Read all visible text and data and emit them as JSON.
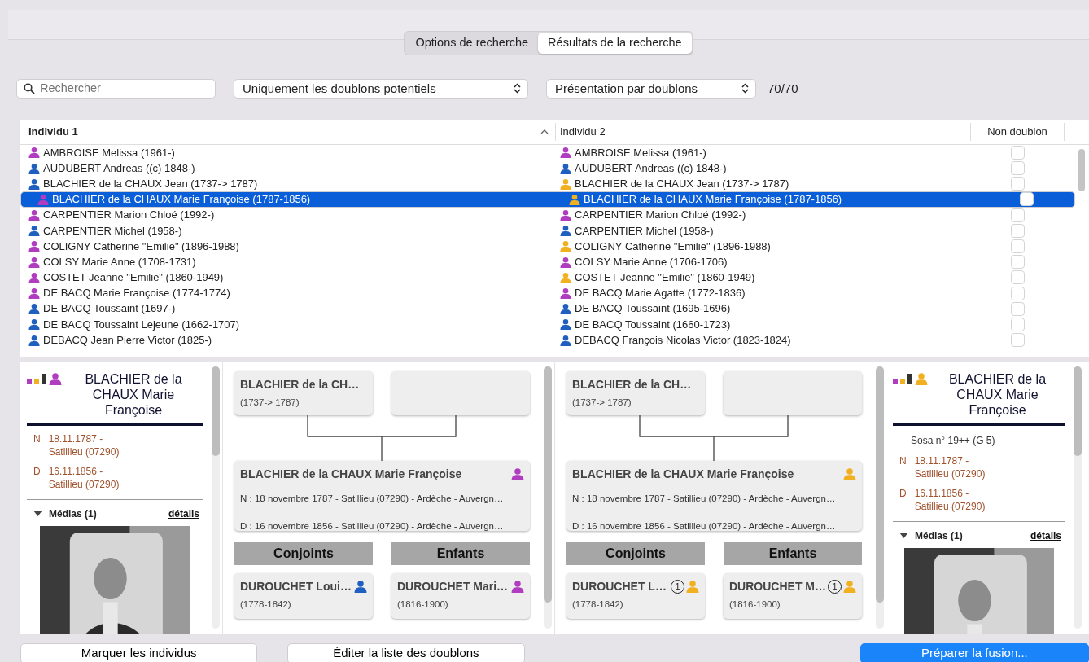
{
  "tabs": [
    {
      "label": "Options de recherche",
      "selected": false
    },
    {
      "label": "Résultats de la recherche",
      "selected": true
    }
  ],
  "search": {
    "placeholder": "Rechercher"
  },
  "filter_select": "Uniquement les doublons potentiels",
  "view_select": "Présentation par doublons",
  "count": "70/70",
  "table": {
    "columns": [
      "Individu 1",
      "Individu 2",
      "Non doublon"
    ],
    "rows": [
      {
        "person_1": {
          "name": "AMBROISE Melissa (1961-)",
          "color": "#b03cc0"
        },
        "person_2": {
          "name": "AMBROISE Melissa (1961-)",
          "color": "#b03cc0"
        },
        "non_doublon": false,
        "selected": false
      },
      {
        "person_1": {
          "name": "AUDUBERT Andreas ((c) 1848-)",
          "color": "#1f5fbf"
        },
        "person_2": {
          "name": "AUDUBERT Andreas ((c) 1848-)",
          "color": "#1f5fbf"
        },
        "non_doublon": false,
        "selected": false
      },
      {
        "person_1": {
          "name": "BLACHIER de la CHAUX Jean (1737-> 1787)",
          "color": "#1f5fbf"
        },
        "person_2": {
          "name": "BLACHIER de la CHAUX Jean (1737-> 1787)",
          "color": "#f0b020"
        },
        "non_doublon": false,
        "selected": false
      },
      {
        "person_1": {
          "name": "BLACHIER de la CHAUX Marie Françoise (1787-1856)",
          "color": "#b03cc0"
        },
        "person_2": {
          "name": "BLACHIER de la CHAUX Marie Françoise (1787-1856)",
          "color": "#f0b020"
        },
        "non_doublon": false,
        "selected": true
      },
      {
        "person_1": {
          "name": "CARPENTIER Marion Chloé (1992-)",
          "color": "#b03cc0"
        },
        "person_2": {
          "name": "CARPENTIER Marion Chloé (1992-)",
          "color": "#b03cc0"
        },
        "non_doublon": false,
        "selected": false
      },
      {
        "person_1": {
          "name": "CARPENTIER Michel (1958-)",
          "color": "#1f5fbf"
        },
        "person_2": {
          "name": "CARPENTIER Michel (1958-)",
          "color": "#1f5fbf"
        },
        "non_doublon": false,
        "selected": false
      },
      {
        "person_1": {
          "name": "COLIGNY Catherine \"Emilie\" (1896-1988)",
          "color": "#b03cc0"
        },
        "person_2": {
          "name": "COLIGNY Catherine \"Emilie\" (1896-1988)",
          "color": "#f0b020"
        },
        "non_doublon": false,
        "selected": false
      },
      {
        "person_1": {
          "name": "COLSY Marie Anne (1708-1731)",
          "color": "#b03cc0"
        },
        "person_2": {
          "name": "COLSY Marie Anne (1706-1706)",
          "color": "#b03cc0"
        },
        "non_doublon": false,
        "selected": false
      },
      {
        "person_1": {
          "name": "COSTET Jeanne \"Emilie\" (1860-1949)",
          "color": "#b03cc0"
        },
        "person_2": {
          "name": "COSTET Jeanne \"Emilie\" (1860-1949)",
          "color": "#f0b020"
        },
        "non_doublon": false,
        "selected": false
      },
      {
        "person_1": {
          "name": "DE BACQ Marie Françoise (1774-1774)",
          "color": "#b03cc0"
        },
        "person_2": {
          "name": "DE BACQ Marie Agatte (1772-1836)",
          "color": "#b03cc0"
        },
        "non_doublon": false,
        "selected": false
      },
      {
        "person_1": {
          "name": "DE BACQ Toussaint (1697-)",
          "color": "#1f5fbf"
        },
        "person_2": {
          "name": "DE BACQ Toussaint (1695-1696)",
          "color": "#1f5fbf"
        },
        "non_doublon": false,
        "selected": false
      },
      {
        "person_1": {
          "name": "DE BACQ Toussaint Lejeune (1662-1707)",
          "color": "#1f5fbf"
        },
        "person_2": {
          "name": "DE BACQ Toussaint (1660-1723)",
          "color": "#1f5fbf"
        },
        "non_doublon": false,
        "selected": false
      },
      {
        "person_1": {
          "name": "DEBACQ Jean Pierre Victor (1825-)",
          "color": "#1f5fbf"
        },
        "person_2": {
          "name": "DEBACQ François Nicolas Victor (1823-1824)",
          "color": "#1f5fbf"
        },
        "non_doublon": false,
        "selected": false
      }
    ]
  },
  "individual_1": {
    "detail": {
      "title": "BLACHIER de la CHAUX Marie Françoise",
      "color": "#b03cc0",
      "events": [
        {
          "type": "N",
          "text": "18.11.1787 - Satillieu (07290)"
        },
        {
          "type": "D",
          "text": "16.11.1856 - Satillieu (07290)"
        }
      ],
      "media": {
        "title": "Médias (1)",
        "link": "détails",
        "kind": "picture"
      }
    },
    "tree": {
      "parents": [
        {
          "kind": "person",
          "name": "BLACHIER de la CH…",
          "dates": "(1737-> 1787)"
        },
        {
          "kind": "empty"
        }
      ],
      "main": {
        "name": "BLACHIER de la CHAUX Marie Françoise",
        "color": "#b03cc0",
        "lines": [
          "N : 18 novembre 1787 - Satillieu (07290) - Ardèche - Auvergn…",
          "D : 16 novembre 1856 - Satillieu (07290) - Ardèche - Auvergn…"
        ]
      },
      "sections": [
        {
          "title": "Conjoints",
          "people": [
            {
              "name": "DUROUCHET Loui…",
              "dates": "(1778-1842)",
              "color": "#1f5fbf"
            }
          ]
        },
        {
          "title": "Enfants",
          "people": [
            {
              "name": "DUROUCHET Mari…",
              "dates": "(1816-1900)",
              "color": "#b03cc0"
            }
          ]
        }
      ]
    }
  },
  "individual_2": {
    "tree": {
      "parents": [
        {
          "kind": "person",
          "name": "BLACHIER de la CH…",
          "dates": "(1737-> 1787)"
        },
        {
          "kind": "empty"
        }
      ],
      "main": {
        "name": "BLACHIER de la CHAUX Marie Françoise",
        "color": "#f0b020",
        "lines": [
          "N : 18 novembre 1787 - Satillieu (07290) - Ardèche - Auvergn…",
          "D : 16 novembre 1856 - Satillieu (07290) - Ardèche - Auvergn…"
        ]
      },
      "sections": [
        {
          "title": "Conjoints",
          "people": [
            {
              "name": "DUROUCHET L…",
              "dates": "(1778-1842)",
              "color": "#f0b020",
              "badge": "1"
            }
          ]
        },
        {
          "title": "Enfants",
          "people": [
            {
              "name": "DUROUCHET M…",
              "dates": "(1816-1900)",
              "color": "#f0b020",
              "badge": "1"
            }
          ]
        }
      ]
    },
    "detail": {
      "title": "BLACHIER de la CHAUX Marie Françoise",
      "color": "#f0b020",
      "sosa": "Sosa n° 19++ (G 5)",
      "events": [
        {
          "type": "N",
          "text": "18.11.1787 - Satillieu (07290)"
        },
        {
          "type": "D",
          "text": "16.11.1856 - Satillieu (07290)"
        }
      ],
      "media": {
        "title": "Médias (1)",
        "link": "détails",
        "kind": "picture"
      }
    }
  },
  "buttons": [
    {
      "label": "Marquer les individus",
      "kind": "normal"
    },
    {
      "label": "Éditer la liste des doublons",
      "kind": "normal"
    },
    {
      "label": "Préparer la fusion...",
      "kind": "primary"
    }
  ]
}
